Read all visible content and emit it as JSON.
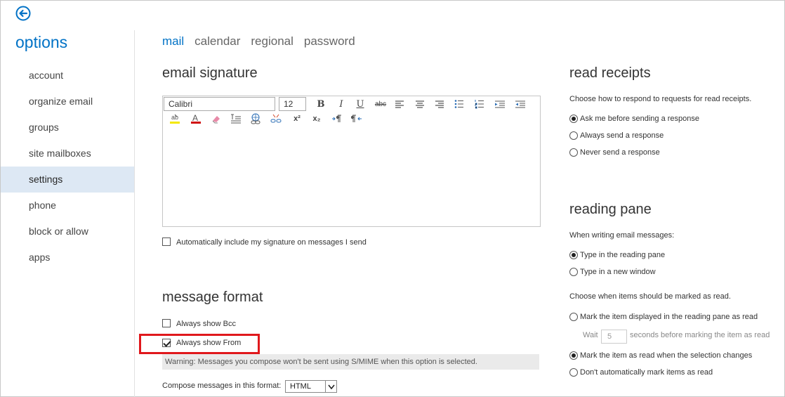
{
  "app": {
    "title": "options",
    "back_icon": "back-arrow-icon",
    "accent": "#0072c6"
  },
  "nav": {
    "items": [
      {
        "label": "account"
      },
      {
        "label": "organize email"
      },
      {
        "label": "groups"
      },
      {
        "label": "site mailboxes"
      },
      {
        "label": "settings",
        "active": true
      },
      {
        "label": "phone"
      },
      {
        "label": "block or allow"
      },
      {
        "label": "apps"
      }
    ]
  },
  "tabs": [
    {
      "label": "mail",
      "active": true
    },
    {
      "label": "calendar"
    },
    {
      "label": "regional"
    },
    {
      "label": "password"
    }
  ],
  "signature": {
    "title": "email signature",
    "font_name": "Calibri",
    "font_size": "12",
    "toolbar": {
      "bold": "B",
      "italic": "I",
      "underline": "U",
      "strike": "abc",
      "superscript": "x²",
      "subscript": "x₂",
      "icons": [
        "bold-icon",
        "italic-icon",
        "underline-icon",
        "strikethrough-icon",
        "align-left-icon",
        "align-center-icon",
        "align-right-icon",
        "bulleted-list-icon",
        "numbered-list-icon",
        "indent-icon",
        "outdent-icon",
        "highlight-icon",
        "font-color-icon",
        "clear-formatting-icon",
        "paragraph-format-icon",
        "insert-link-icon",
        "remove-link-icon",
        "superscript-icon",
        "subscript-icon",
        "ltr-icon",
        "rtl-icon"
      ]
    },
    "auto_include_label": "Automatically include my signature on messages I send",
    "auto_include_checked": false
  },
  "message_format": {
    "title": "message format",
    "bcc_label": "Always show Bcc",
    "bcc_checked": false,
    "from_label": "Always show From",
    "from_checked": true,
    "highlight_color": "#e0181c",
    "warning": "Warning: Messages you compose won't be sent using S/MIME when this option is selected.",
    "compose_label": "Compose messages in this format:",
    "compose_value": "HTML"
  },
  "read_receipts": {
    "title": "read receipts",
    "description": "Choose how to respond to requests for read receipts.",
    "options": [
      {
        "label": "Ask me before sending a response",
        "checked": true
      },
      {
        "label": "Always send a response",
        "checked": false
      },
      {
        "label": "Never send a response",
        "checked": false
      }
    ]
  },
  "reading_pane": {
    "title": "reading pane",
    "writing_desc": "When writing email messages:",
    "writing_options": [
      {
        "label": "Type in the reading pane",
        "checked": true
      },
      {
        "label": "Type in a new window",
        "checked": false
      }
    ],
    "mark_desc": "Choose when items should be marked as read.",
    "mark_option_1": "Mark the item displayed in the reading pane as read",
    "wait_label": "Wait",
    "wait_value": "5",
    "wait_suffix": "seconds before marking the item as read",
    "mark_option_2": "Mark the item as read when the selection changes",
    "mark_option_3": "Don't automatically mark items as read",
    "mark_selected": 2
  }
}
